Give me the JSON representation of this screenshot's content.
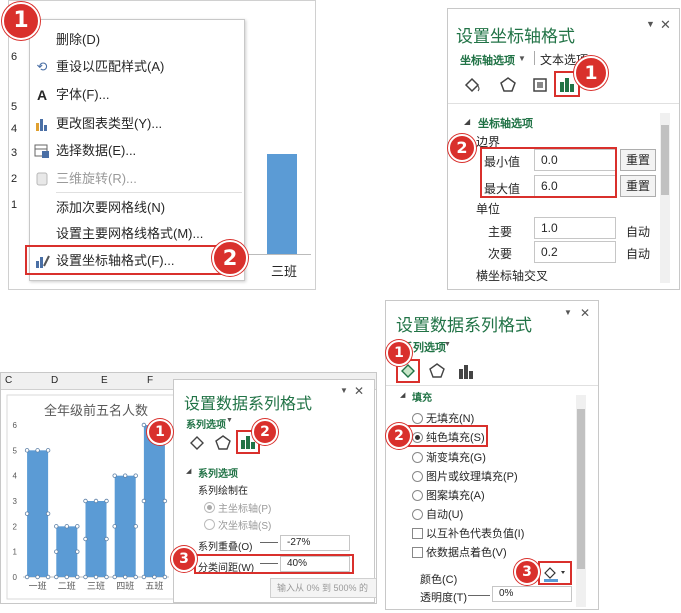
{
  "context_menu": {
    "axis_ticks": [
      "6",
      "5",
      "4",
      "3",
      "2",
      "1"
    ],
    "items": [
      {
        "label": "删除(D)",
        "icon": "delete-icon",
        "enabled": true
      },
      {
        "label": "重设以匹配样式(A)",
        "icon": "reset-style-icon",
        "enabled": true
      },
      {
        "label": "字体(F)...",
        "icon": "font-icon",
        "enabled": true
      },
      {
        "label": "更改图表类型(Y)...",
        "icon": "chart-type-icon",
        "enabled": true
      },
      {
        "label": "选择数据(E)...",
        "icon": "select-data-icon",
        "enabled": true
      },
      {
        "label": "三维旋转(R)...",
        "icon": "rotate-3d-icon",
        "enabled": false
      },
      {
        "label": "添加次要网格线(N)",
        "icon": "",
        "enabled": true
      },
      {
        "label": "设置主要网格线格式(M)...",
        "icon": "",
        "enabled": true
      },
      {
        "label": "设置坐标轴格式(F)...",
        "icon": "format-axis-icon",
        "enabled": true
      }
    ],
    "bar_label": "三班",
    "bar_color": "#5b9bd5"
  },
  "axis_pane": {
    "title": "设置坐标轴格式",
    "tab_axis_options": "坐标轴选项",
    "tab_text_options": "文本选项",
    "section": "坐标轴选项",
    "bounds_label": "边界",
    "min_label": "最小值",
    "min_value": "0.0",
    "max_label": "最大值",
    "max_value": "6.0",
    "reset_label": "重置",
    "units_label": "单位",
    "major_label": "主要",
    "major_value": "1.0",
    "minor_label": "次要",
    "minor_value": "0.2",
    "auto_label": "自动",
    "cross_label": "横坐标轴交叉"
  },
  "chart_pane": {
    "columns": [
      "C",
      "D",
      "E",
      "F"
    ],
    "chart_data": {
      "type": "bar",
      "title": "全年级前五名人数",
      "categories": [
        "一班",
        "二班",
        "三班",
        "四班",
        "五班"
      ],
      "values": [
        5,
        2,
        3,
        4,
        6
      ],
      "ylim": [
        0,
        6
      ],
      "yticks": [
        "0",
        "1",
        "2",
        "3",
        "4",
        "5",
        "6"
      ],
      "color": "#5b9bd5",
      "grid": false
    },
    "pane_title": "设置数据系列格式",
    "tab_series_options": "系列选项",
    "section": "系列选项",
    "plot_on_label": "系列绘制在",
    "primary_axis": "主坐标轴(P)",
    "secondary_axis": "次坐标轴(S)",
    "overlap_label": "系列重叠(O)",
    "overlap_value": "-27%",
    "gap_label": "分类间距(W)",
    "gap_value": "40%",
    "tooltip": "输入从 0% 到 500% 的"
  },
  "fill_pane": {
    "title": "设置数据系列格式",
    "tab_series_options": "系列选项",
    "section": "填充",
    "options": [
      {
        "label": "无填充(N)",
        "type": "radio",
        "checked": false
      },
      {
        "label": "纯色填充(S)",
        "type": "radio",
        "checked": true
      },
      {
        "label": "渐变填充(G)",
        "type": "radio",
        "checked": false
      },
      {
        "label": "图片或纹理填充(P)",
        "type": "radio",
        "checked": false
      },
      {
        "label": "图案填充(A)",
        "type": "radio",
        "checked": false
      },
      {
        "label": "自动(U)",
        "type": "radio",
        "checked": false
      },
      {
        "label": "以互补色代表负值(I)",
        "type": "checkbox",
        "checked": false
      },
      {
        "label": "依数据点着色(V)",
        "type": "checkbox",
        "checked": false
      }
    ],
    "color_label": "颜色(C)",
    "transparency_label": "透明度(T)",
    "transparency_value": "0%"
  },
  "badges": {
    "one": "1",
    "two": "2",
    "three": "3"
  },
  "close_glyph": "✕",
  "dropdown_glyph": "▼"
}
